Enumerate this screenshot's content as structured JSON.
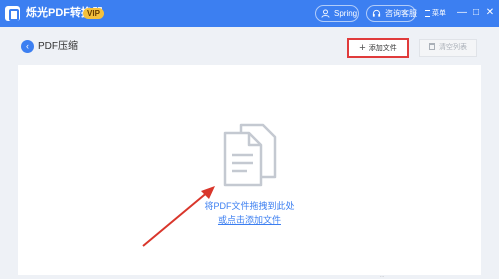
{
  "app": {
    "title": "烁光PDF转换器",
    "vip_badge": "VIP"
  },
  "titlebar": {
    "user_label": "Spring",
    "service_label": "咨询客服",
    "menu_label": "菜单",
    "minimize_glyph": "—",
    "maximize_glyph": "□",
    "close_glyph": "✕"
  },
  "toolbar": {
    "back_glyph": "‹",
    "page_title": "PDF压缩",
    "add_file_label": "添加文件",
    "add_glyph": "+",
    "clear_list_label": "清空列表"
  },
  "dropzone": {
    "hint": "将PDF文件拖拽到此处",
    "link": "或点击添加文件"
  },
  "status": {
    "text": "..."
  },
  "colors": {
    "accent": "#3c7ff1",
    "highlight": "#e03b3b",
    "annotation_arrow": "#d9362b"
  }
}
